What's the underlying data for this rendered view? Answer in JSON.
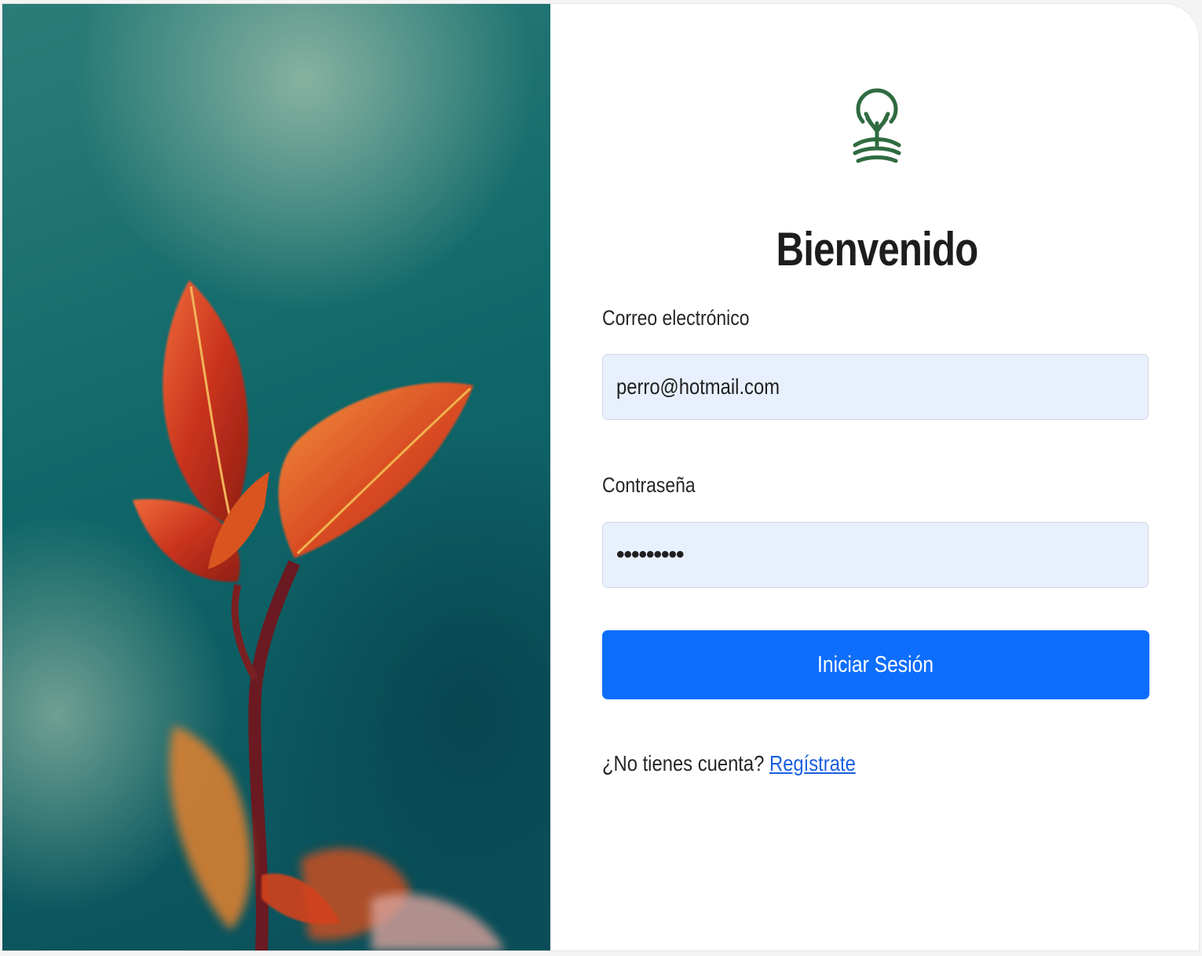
{
  "login": {
    "title": "Bienvenido",
    "email_label": "Correo electrónico",
    "email_value": "perro@hotmail.com",
    "password_label": "Contraseña",
    "password_value": "•••••••••",
    "submit_label": "Iniciar Sesión",
    "register_prompt": "¿No tienes cuenta?",
    "register_link": "Regístrate"
  },
  "colors": {
    "accent": "#0d6efd",
    "logo": "#2f6b3f",
    "input_bg": "#e8f0fe",
    "link": "#1a5fe0"
  },
  "icons": {
    "logo": "tree-logo-icon"
  }
}
